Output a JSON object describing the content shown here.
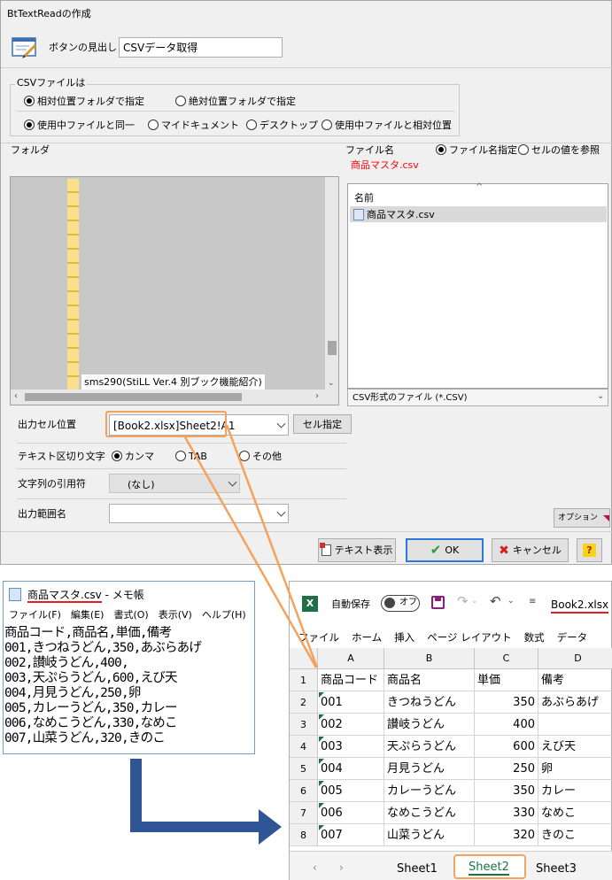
{
  "dialog": {
    "title": "BtTextReadの作成",
    "button_caption_label": "ボタンの見出し",
    "button_caption_value": "CSVデータ取得",
    "csv_group_label": "CSVファイルは",
    "path_mode": {
      "relative": "相対位置フォルダで指定",
      "absolute": "絶対位置フォルダで指定"
    },
    "base_mode": {
      "same_as_current": "使用中ファイルと同一",
      "my_documents": "マイドキュメント",
      "desktop": "デスクトップ",
      "relative_to_current": "使用中ファイルと相対位置"
    },
    "folder_label": "フォルダ",
    "folder_item": "sms290(StiLL Ver.4 別ブック機能紹介)",
    "filename_label": "ファイル名",
    "filename_value": "商品マスタ.csv",
    "filename_mode": {
      "specify": "ファイル名指定",
      "cell_ref": "セルの値を参照"
    },
    "file_list_header": "名前",
    "file_list_items": [
      "商品マスタ.csv"
    ],
    "file_type_filter": "CSV形式のファイル (*.CSV)",
    "output_cell_label": "出力セル位置",
    "output_cell_value": "[Book2.xlsx]Sheet2!A1",
    "cell_select_button": "セル指定",
    "delimiter_label": "テキスト区切り文字",
    "delimiter_options": {
      "comma": "カンマ",
      "tab": "TAB",
      "other": "その他"
    },
    "quote_label": "文字列の引用符",
    "quote_value": "(なし)",
    "range_name_label": "出力範囲名",
    "range_name_value": "",
    "options_button": "オプション",
    "text_view_button": "テキスト表示",
    "ok_button": "OK",
    "cancel_button": "キャンセル",
    "help_button": "?"
  },
  "notepad": {
    "title_file": "商品マスタ.csv",
    "title_app": " - メモ帳",
    "menu": [
      "ファイル(F)",
      "編集(E)",
      "書式(O)",
      "表示(V)",
      "ヘルプ(H)"
    ],
    "lines": [
      "商品コード,商品名,単価,備考",
      "001,きつねうどん,350,あぶらあげ",
      "002,讃岐うどん,400,",
      "003,天ぷらうどん,600,えび天",
      "004,月見うどん,250,卵",
      "005,カレーうどん,350,カレー",
      "006,なめこうどん,330,なめこ",
      "007,山菜うどん,320,きのこ"
    ]
  },
  "excel": {
    "autosave_label": "自動保存",
    "autosave_state": "オフ",
    "filename": "Book2.xlsx",
    "ribbon_tabs": [
      "ファイル",
      "ホーム",
      "挿入",
      "ページ レイアウト",
      "数式",
      "データ"
    ],
    "columns": [
      "A",
      "B",
      "C",
      "D"
    ],
    "rows": [
      {
        "num": "1",
        "cells": [
          "商品コード",
          "商品名",
          "単価",
          "備考"
        ]
      },
      {
        "num": "2",
        "cells": [
          "001",
          "きつねうどん",
          "350",
          "あぶらあげ"
        ]
      },
      {
        "num": "3",
        "cells": [
          "002",
          "讃岐うどん",
          "400",
          ""
        ]
      },
      {
        "num": "4",
        "cells": [
          "003",
          "天ぷらうどん",
          "600",
          "えび天"
        ]
      },
      {
        "num": "5",
        "cells": [
          "004",
          "月見うどん",
          "250",
          "卵"
        ]
      },
      {
        "num": "6",
        "cells": [
          "005",
          "カレーうどん",
          "350",
          "カレー"
        ]
      },
      {
        "num": "7",
        "cells": [
          "006",
          "なめこうどん",
          "330",
          "なめこ"
        ]
      },
      {
        "num": "8",
        "cells": [
          "007",
          "山菜うどん",
          "320",
          "きのこ"
        ]
      }
    ],
    "sheet_tabs": [
      "Sheet1",
      "Sheet2",
      "Sheet3"
    ],
    "active_sheet": "Sheet2"
  },
  "colors": {
    "highlight_orange": "#f5a25d",
    "arrow_blue": "#2f5597",
    "red_text": "#ff0000",
    "excel_green": "#1e7145"
  }
}
